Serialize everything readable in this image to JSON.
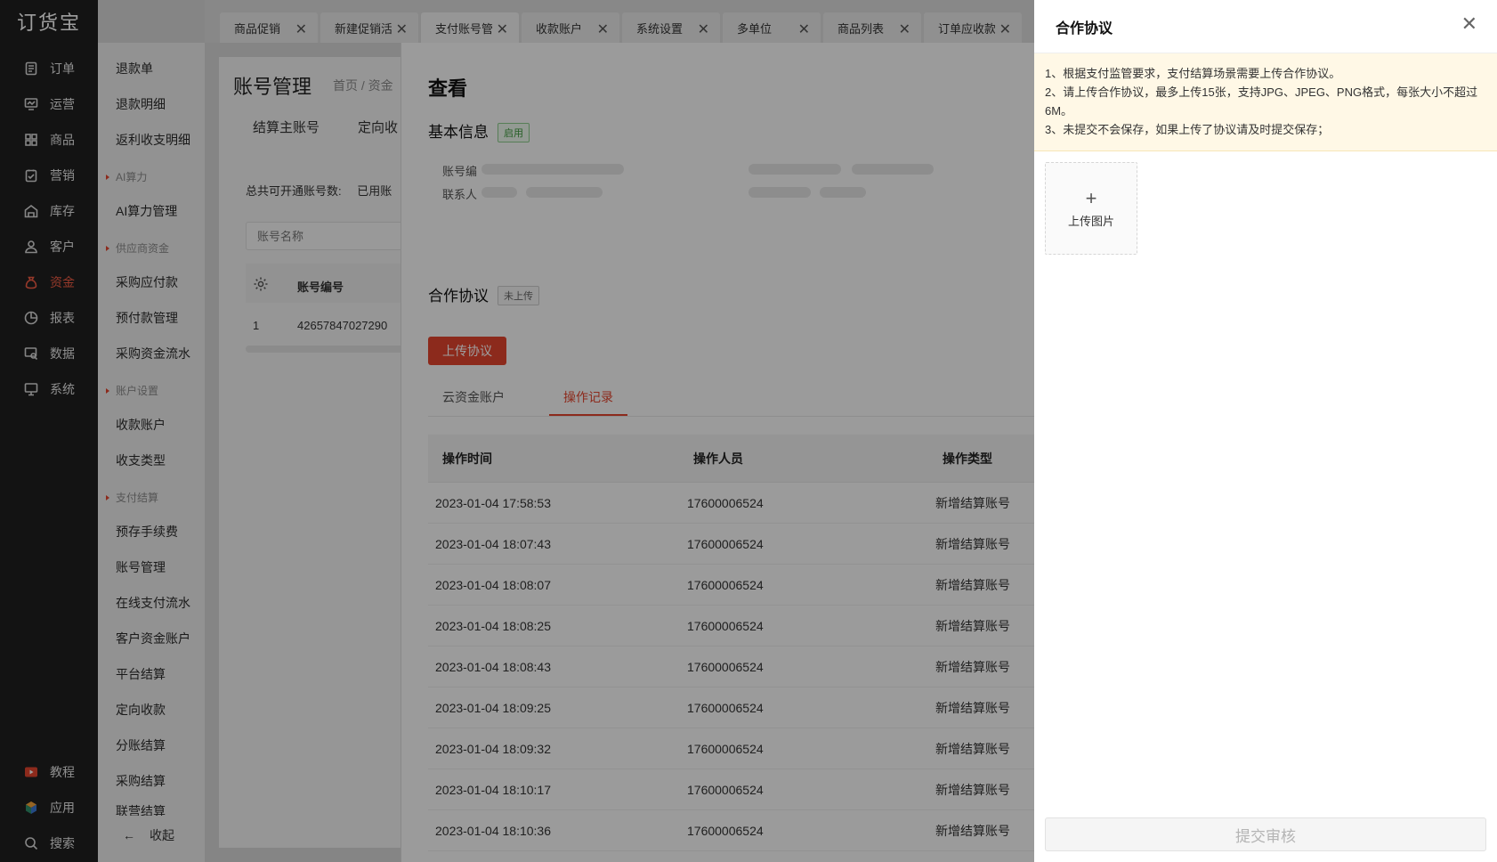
{
  "app": {
    "logo": "订货宝"
  },
  "nav": {
    "items": [
      {
        "label": "订单",
        "icon": "order-icon"
      },
      {
        "label": "运营",
        "icon": "operation-icon"
      },
      {
        "label": "商品",
        "icon": "goods-icon"
      },
      {
        "label": "营销",
        "icon": "marketing-icon"
      },
      {
        "label": "库存",
        "icon": "inventory-icon"
      },
      {
        "label": "客户",
        "icon": "customer-icon"
      },
      {
        "label": "资金",
        "icon": "funds-icon",
        "active": true
      },
      {
        "label": "报表",
        "icon": "report-icon"
      },
      {
        "label": "数据",
        "icon": "data-icon"
      },
      {
        "label": "系统",
        "icon": "system-icon"
      }
    ],
    "bottom": [
      {
        "label": "教程",
        "icon": "tutorial-icon"
      },
      {
        "label": "应用",
        "icon": "apps-icon"
      },
      {
        "label": "搜索",
        "icon": "search-icon"
      }
    ]
  },
  "subnav": {
    "items": [
      "退款单",
      "退款明细",
      "返利收支明细",
      "AI算力",
      "AI算力管理",
      "供应商资金",
      "采购应付款",
      "预付款管理",
      "采购资金流水",
      "账户设置",
      "收款账户",
      "收支类型",
      "支付结算",
      "预存手续费",
      "账号管理",
      "在线支付流水",
      "客户资金账户",
      "平台结算",
      "定向收款",
      "分账结算",
      "采购结算",
      "联营结算"
    ],
    "collapse_arrow": "←",
    "collapse_label": "收起"
  },
  "tabs": [
    {
      "label": "商品促销"
    },
    {
      "label": "新建促销活动"
    },
    {
      "label": "支付账号管理"
    },
    {
      "label": "收款账户"
    },
    {
      "label": "系统设置"
    },
    {
      "label": "多单位"
    },
    {
      "label": "商品列表"
    },
    {
      "label": "订单应收款"
    }
  ],
  "page": {
    "title": "账号管理",
    "breadcrumb": "首页 / 资金",
    "tabs": [
      "结算主账号",
      "定向收"
    ],
    "total_label": "总共可开通账号数:",
    "used_label": "已用账",
    "search_placeholder": "账号名称",
    "table": {
      "col_account_no": "账号编号",
      "row_index": "1",
      "row_account_no": "42657847027290"
    }
  },
  "view": {
    "title": "查看",
    "basic_info": {
      "title": "基本信息",
      "status": "启用",
      "account_label": "账号编",
      "contact_label": "联系人"
    },
    "agreement": {
      "title": "合作协议",
      "status": "未上传",
      "upload_button": "上传协议"
    },
    "tabs": [
      "云资金账户",
      "操作记录"
    ],
    "active_tab": "操作记录",
    "ops_table": {
      "columns": [
        "操作时间",
        "操作人员",
        "操作类型"
      ],
      "rows": [
        {
          "time": "2023-01-04 17:58:53",
          "operator": "17600006524",
          "type": "新增结算账号"
        },
        {
          "time": "2023-01-04 18:07:43",
          "operator": "17600006524",
          "type": "新增结算账号"
        },
        {
          "time": "2023-01-04 18:08:07",
          "operator": "17600006524",
          "type": "新增结算账号"
        },
        {
          "time": "2023-01-04 18:08:25",
          "operator": "17600006524",
          "type": "新增结算账号"
        },
        {
          "time": "2023-01-04 18:08:43",
          "operator": "17600006524",
          "type": "新增结算账号"
        },
        {
          "time": "2023-01-04 18:09:25",
          "operator": "17600006524",
          "type": "新增结算账号"
        },
        {
          "time": "2023-01-04 18:09:32",
          "operator": "17600006524",
          "type": "新增结算账号"
        },
        {
          "time": "2023-01-04 18:10:17",
          "operator": "17600006524",
          "type": "新增结算账号"
        },
        {
          "time": "2023-01-04 18:10:36",
          "operator": "17600006524",
          "type": "新增结算账号"
        }
      ]
    }
  },
  "drawer": {
    "title": "合作协议",
    "notices": [
      "1、根据支付监管要求，支付结算场景需要上传合作协议。",
      "2、请上传合作协议，最多上传15张，支持JPG、JPEG、PNG格式，每张大小不超过6M。",
      "3、未提交不会保存，如果上传了协议请及时提交保存；"
    ],
    "upload_plus": "+",
    "upload_label": "上传图片",
    "submit_label": "提交审核"
  },
  "colors": {
    "accent": "#e2452e",
    "nav_bg": "#1f1f1f",
    "notice_bg": "#fff8e6"
  }
}
